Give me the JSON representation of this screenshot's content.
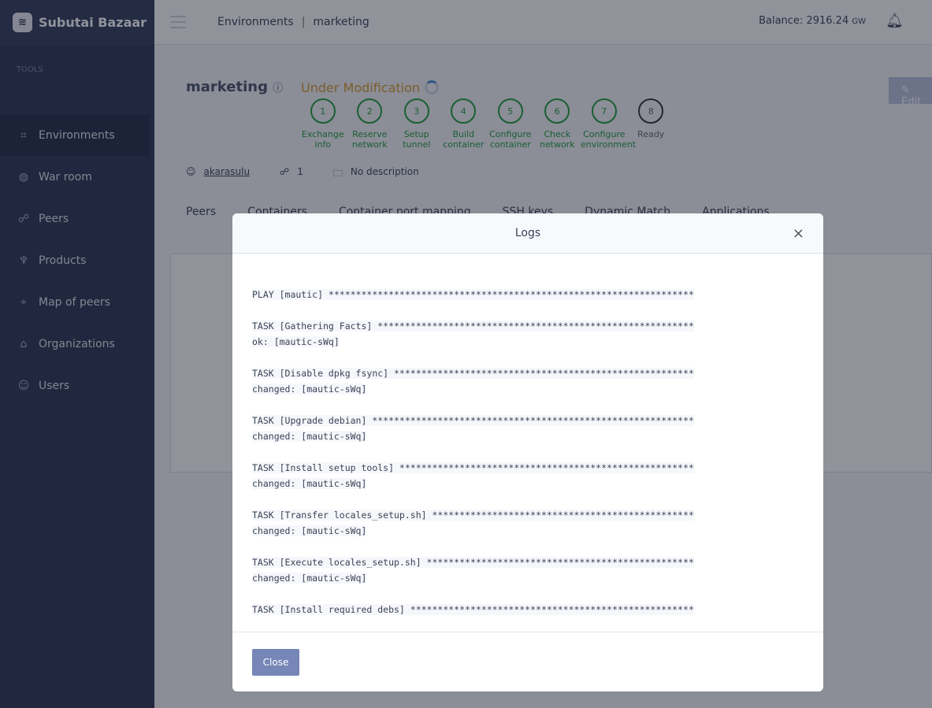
{
  "brand": "Subutai Bazaar",
  "sidebar": {
    "section": "TOOLS",
    "items": [
      {
        "label": "Environments",
        "icon": "environments-icon",
        "glyph": "⌗"
      },
      {
        "label": "War room",
        "icon": "globe-icon",
        "glyph": "◍"
      },
      {
        "label": "Peers",
        "icon": "peers-icon",
        "glyph": "☍"
      },
      {
        "label": "Products",
        "icon": "basket-icon",
        "glyph": "♆"
      },
      {
        "label": "Map of peers",
        "icon": "map-pin-icon",
        "glyph": "⌖"
      },
      {
        "label": "Organizations",
        "icon": "building-icon",
        "glyph": "⌂"
      },
      {
        "label": "Users",
        "icon": "user-icon",
        "glyph": "☺"
      }
    ]
  },
  "header": {
    "breadcrumb": [
      "Environments",
      "marketing"
    ],
    "balance_label": "Balance:",
    "balance": "2916.24",
    "balance_unit": "GW"
  },
  "env": {
    "name": "marketing",
    "status": "Under Modification",
    "owner": "akarasulu",
    "peers": "1",
    "description": "No description",
    "edit": "Edit"
  },
  "steps": [
    {
      "n": "1",
      "l1": "Exchange",
      "l2": "info"
    },
    {
      "n": "2",
      "l1": "Reserve",
      "l2": "network"
    },
    {
      "n": "3",
      "l1": "Setup",
      "l2": "tunnel"
    },
    {
      "n": "4",
      "l1": "Build",
      "l2": "container"
    },
    {
      "n": "5",
      "l1": "Configure",
      "l2": "container"
    },
    {
      "n": "6",
      "l1": "Check",
      "l2": "network"
    },
    {
      "n": "7",
      "l1": "Configure",
      "l2": "environment"
    },
    {
      "n": "8",
      "l1": "Ready",
      "l2": ""
    }
  ],
  "tabs": [
    "Peers",
    "Containers",
    "Container port mapping",
    "SSH keys",
    "Dynamic Match",
    "Applications"
  ],
  "modal": {
    "title": "Logs",
    "close": "Close",
    "lines": [
      "PLAY [mautic] *******************************************************************",
      "",
      "TASK [Gathering Facts] **********************************************************",
      "ok: [mautic-sWq]",
      "",
      "TASK [Disable dpkg fsync] *******************************************************",
      "changed: [mautic-sWq]",
      "",
      "TASK [Upgrade debian] ***********************************************************",
      "changed: [mautic-sWq]",
      "",
      "TASK [Install setup tools] ******************************************************",
      "changed: [mautic-sWq]",
      "",
      "TASK [Transfer locales_setup.sh] ************************************************",
      "changed: [mautic-sWq]",
      "",
      "TASK [Execute locales_setup.sh] *************************************************",
      "changed: [mautic-sWq]",
      "",
      "TASK [Install required debs] ****************************************************"
    ]
  }
}
